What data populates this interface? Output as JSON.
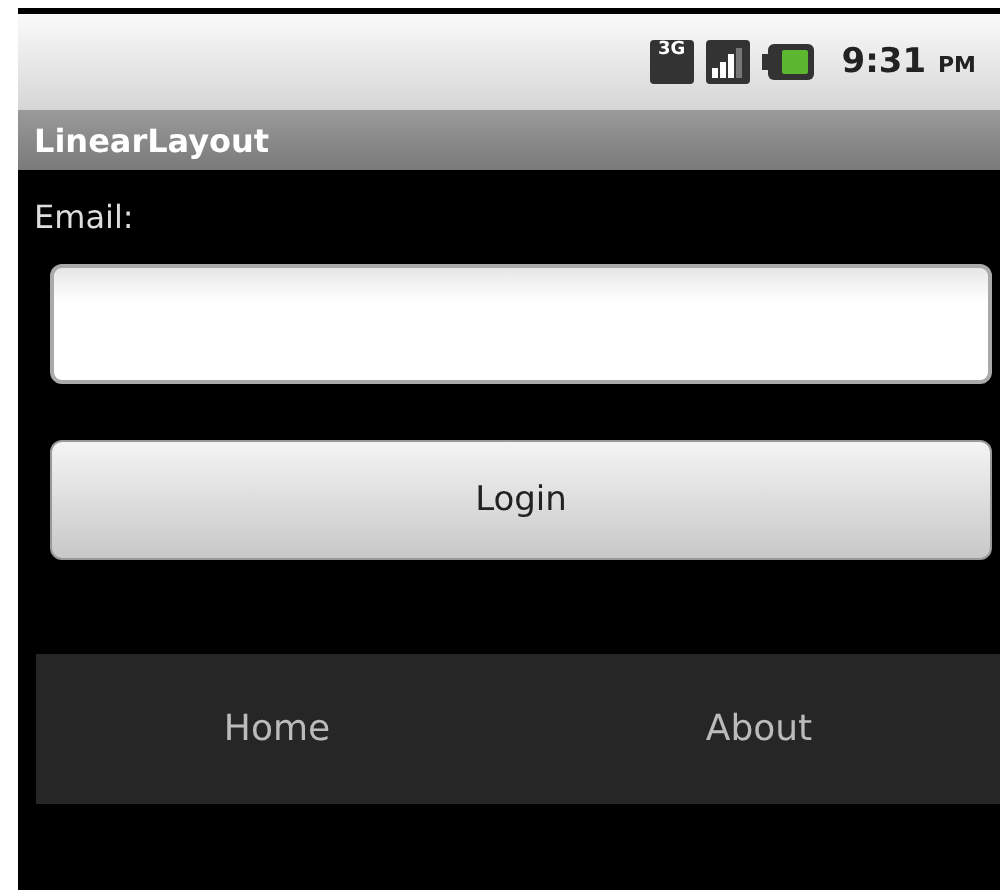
{
  "status_bar": {
    "network": "3G",
    "time": "9:31",
    "meridiem": "PM"
  },
  "window": {
    "title": "LinearLayout"
  },
  "form": {
    "label": "Email:",
    "button": "Login"
  },
  "nav": [
    {
      "label": "Home"
    },
    {
      "label": "About"
    }
  ]
}
